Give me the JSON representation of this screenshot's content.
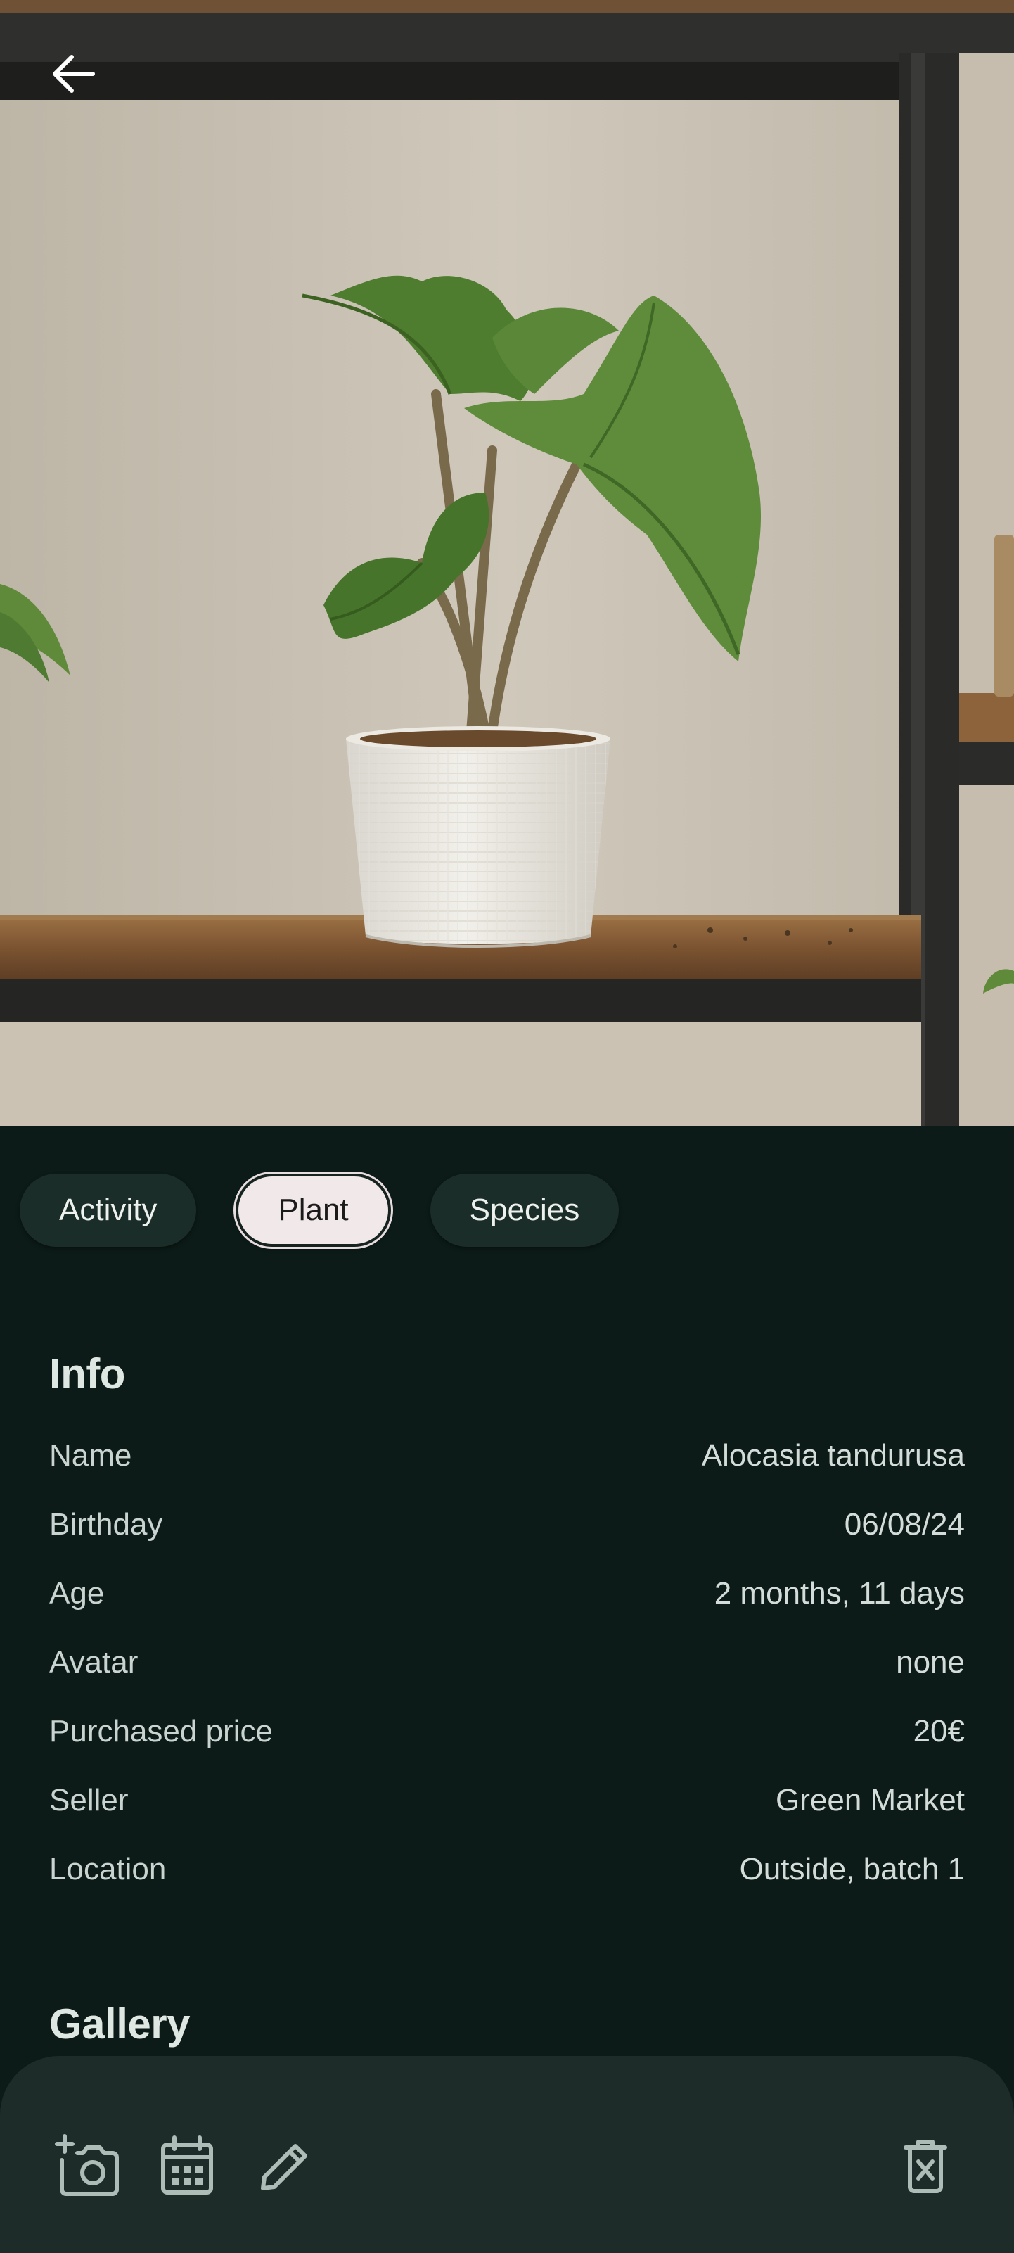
{
  "header": {
    "back_icon": "arrow-back-icon"
  },
  "tabs": [
    {
      "label": "Activity",
      "selected": false
    },
    {
      "label": "Plant",
      "selected": true
    },
    {
      "label": "Species",
      "selected": false
    }
  ],
  "info": {
    "title": "Info",
    "rows": [
      {
        "label": "Name",
        "value": "Alocasia tandurusa"
      },
      {
        "label": "Birthday",
        "value": "06/08/24"
      },
      {
        "label": "Age",
        "value": "2 months, 11 days"
      },
      {
        "label": "Avatar",
        "value": "none"
      },
      {
        "label": "Purchased price",
        "value": "20€"
      },
      {
        "label": "Seller",
        "value": "Green Market"
      },
      {
        "label": "Location",
        "value": "Outside, batch 1"
      }
    ]
  },
  "gallery": {
    "title": "Gallery"
  },
  "bottom_bar": {
    "icons": [
      "add-photo-icon",
      "calendar-icon",
      "edit-icon",
      "delete-icon"
    ]
  },
  "colors": {
    "background": "#0c1b17",
    "tab_background": "#1b2d28",
    "tab_selected": "#f1e8ea",
    "bottom_bar": "#1d2c28",
    "icon": "#aebcb7"
  }
}
